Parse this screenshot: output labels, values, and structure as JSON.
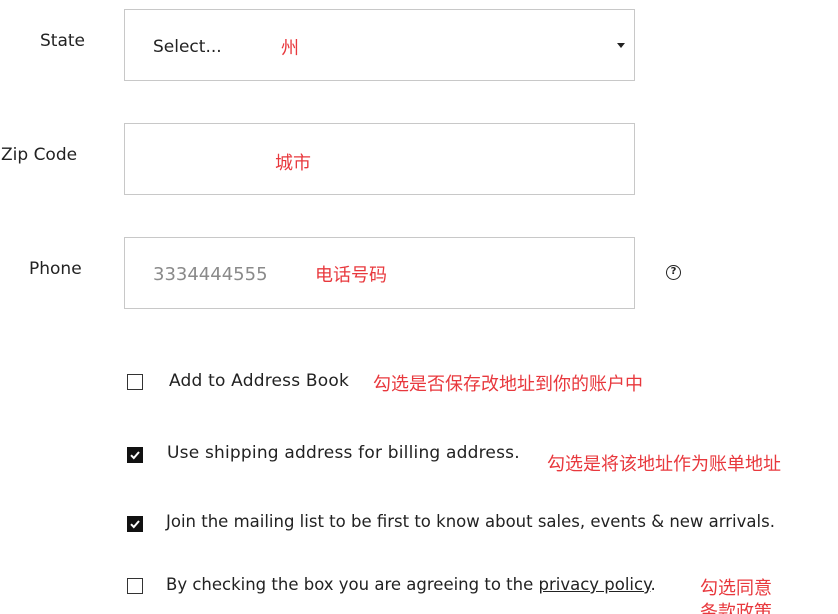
{
  "form": {
    "state": {
      "label": "State",
      "value": "Select...",
      "note": "州"
    },
    "zip": {
      "label": "Zip Code",
      "value": "",
      "note": "城市"
    },
    "phone": {
      "label": "Phone",
      "placeholder": "3334444555",
      "note": "电话号码"
    }
  },
  "checkboxes": [
    {
      "label": "Add to Address Book",
      "checked": false,
      "note": "勾选是否保存改地址到你的账户中"
    },
    {
      "label": "Use shipping address for billing address.",
      "checked": true,
      "note": "勾选是将该地址作为账单地址"
    },
    {
      "label": "Join the mailing list to be first to know about sales, events & new arrivals.",
      "checked": true
    },
    {
      "label_prefix": "By checking the box you are agreeing to the ",
      "link": "privacy policy",
      "label_suffix": ".",
      "checked": false,
      "note_line1": "勾选同意",
      "note_line2": "条款政策"
    }
  ],
  "icons": {
    "help": "question-circle-icon",
    "select_caret": "caret-down-icon",
    "check": "check-icon"
  }
}
